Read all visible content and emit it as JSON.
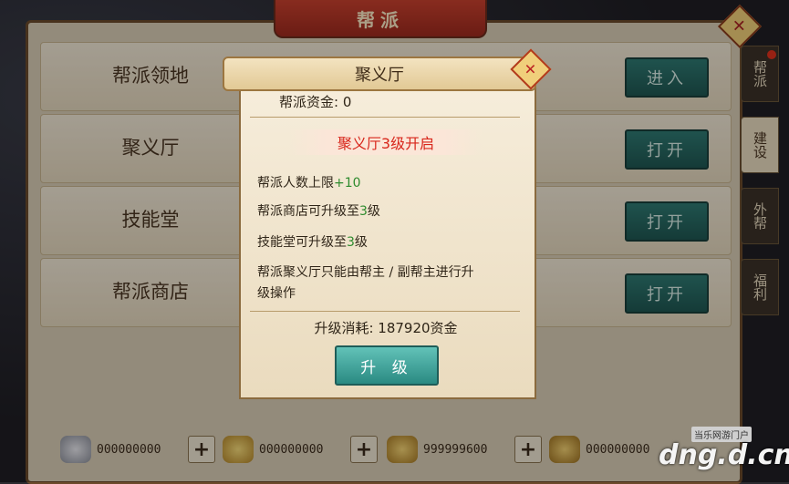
{
  "window": {
    "title": "帮派",
    "close_icon": "close-icon"
  },
  "rows": [
    {
      "label": "帮派领地",
      "button": "进入"
    },
    {
      "label": "聚义厅",
      "button": "打开"
    },
    {
      "label": "技能堂",
      "button": "打开"
    },
    {
      "label": "帮派商店",
      "button": "打开"
    }
  ],
  "tabs": [
    {
      "label": "帮派",
      "active": false,
      "badge": true
    },
    {
      "label": "建设",
      "active": true,
      "badge": false
    },
    {
      "label": "外帮",
      "active": false,
      "badge": false
    },
    {
      "label": "福利",
      "active": false,
      "badge": false
    }
  ],
  "resources": [
    {
      "icon": "silver-ingot-icon",
      "value": "000000000",
      "plus": "+"
    },
    {
      "icon": "gold-ingot-icon",
      "value": "000000000",
      "plus": "+"
    },
    {
      "icon": "gold-pouch-icon",
      "value": "999999600",
      "plus": "+"
    },
    {
      "icon": "gold-sack-icon",
      "value": "000000000",
      "plus": "+"
    }
  ],
  "modal": {
    "title": "聚义厅",
    "fund_label": "帮派资金:",
    "fund_value": "0",
    "banner": "聚义厅3级开启",
    "info": {
      "line1_text": "帮派人数上限",
      "line1_value": "+10",
      "line2_text": "帮派商店可升级至",
      "line2_value": "3",
      "line2_suffix": "级",
      "line3_text": "技能堂可升级至",
      "line3_value": "3",
      "line3_suffix": "级",
      "line4": "帮派聚义厅只能由帮主 / 副帮主进行升",
      "line5": "级操作"
    },
    "cost_label": "升级消耗:",
    "cost_value": "187920资金",
    "upgrade_button": "升 级"
  },
  "watermark": {
    "top": "当乐网游门户",
    "main": "dng.d.cn"
  },
  "colors": {
    "accent_teal": "#2a8a82",
    "banner_red": "#d8261b",
    "green_value": "#2e8b2e"
  }
}
